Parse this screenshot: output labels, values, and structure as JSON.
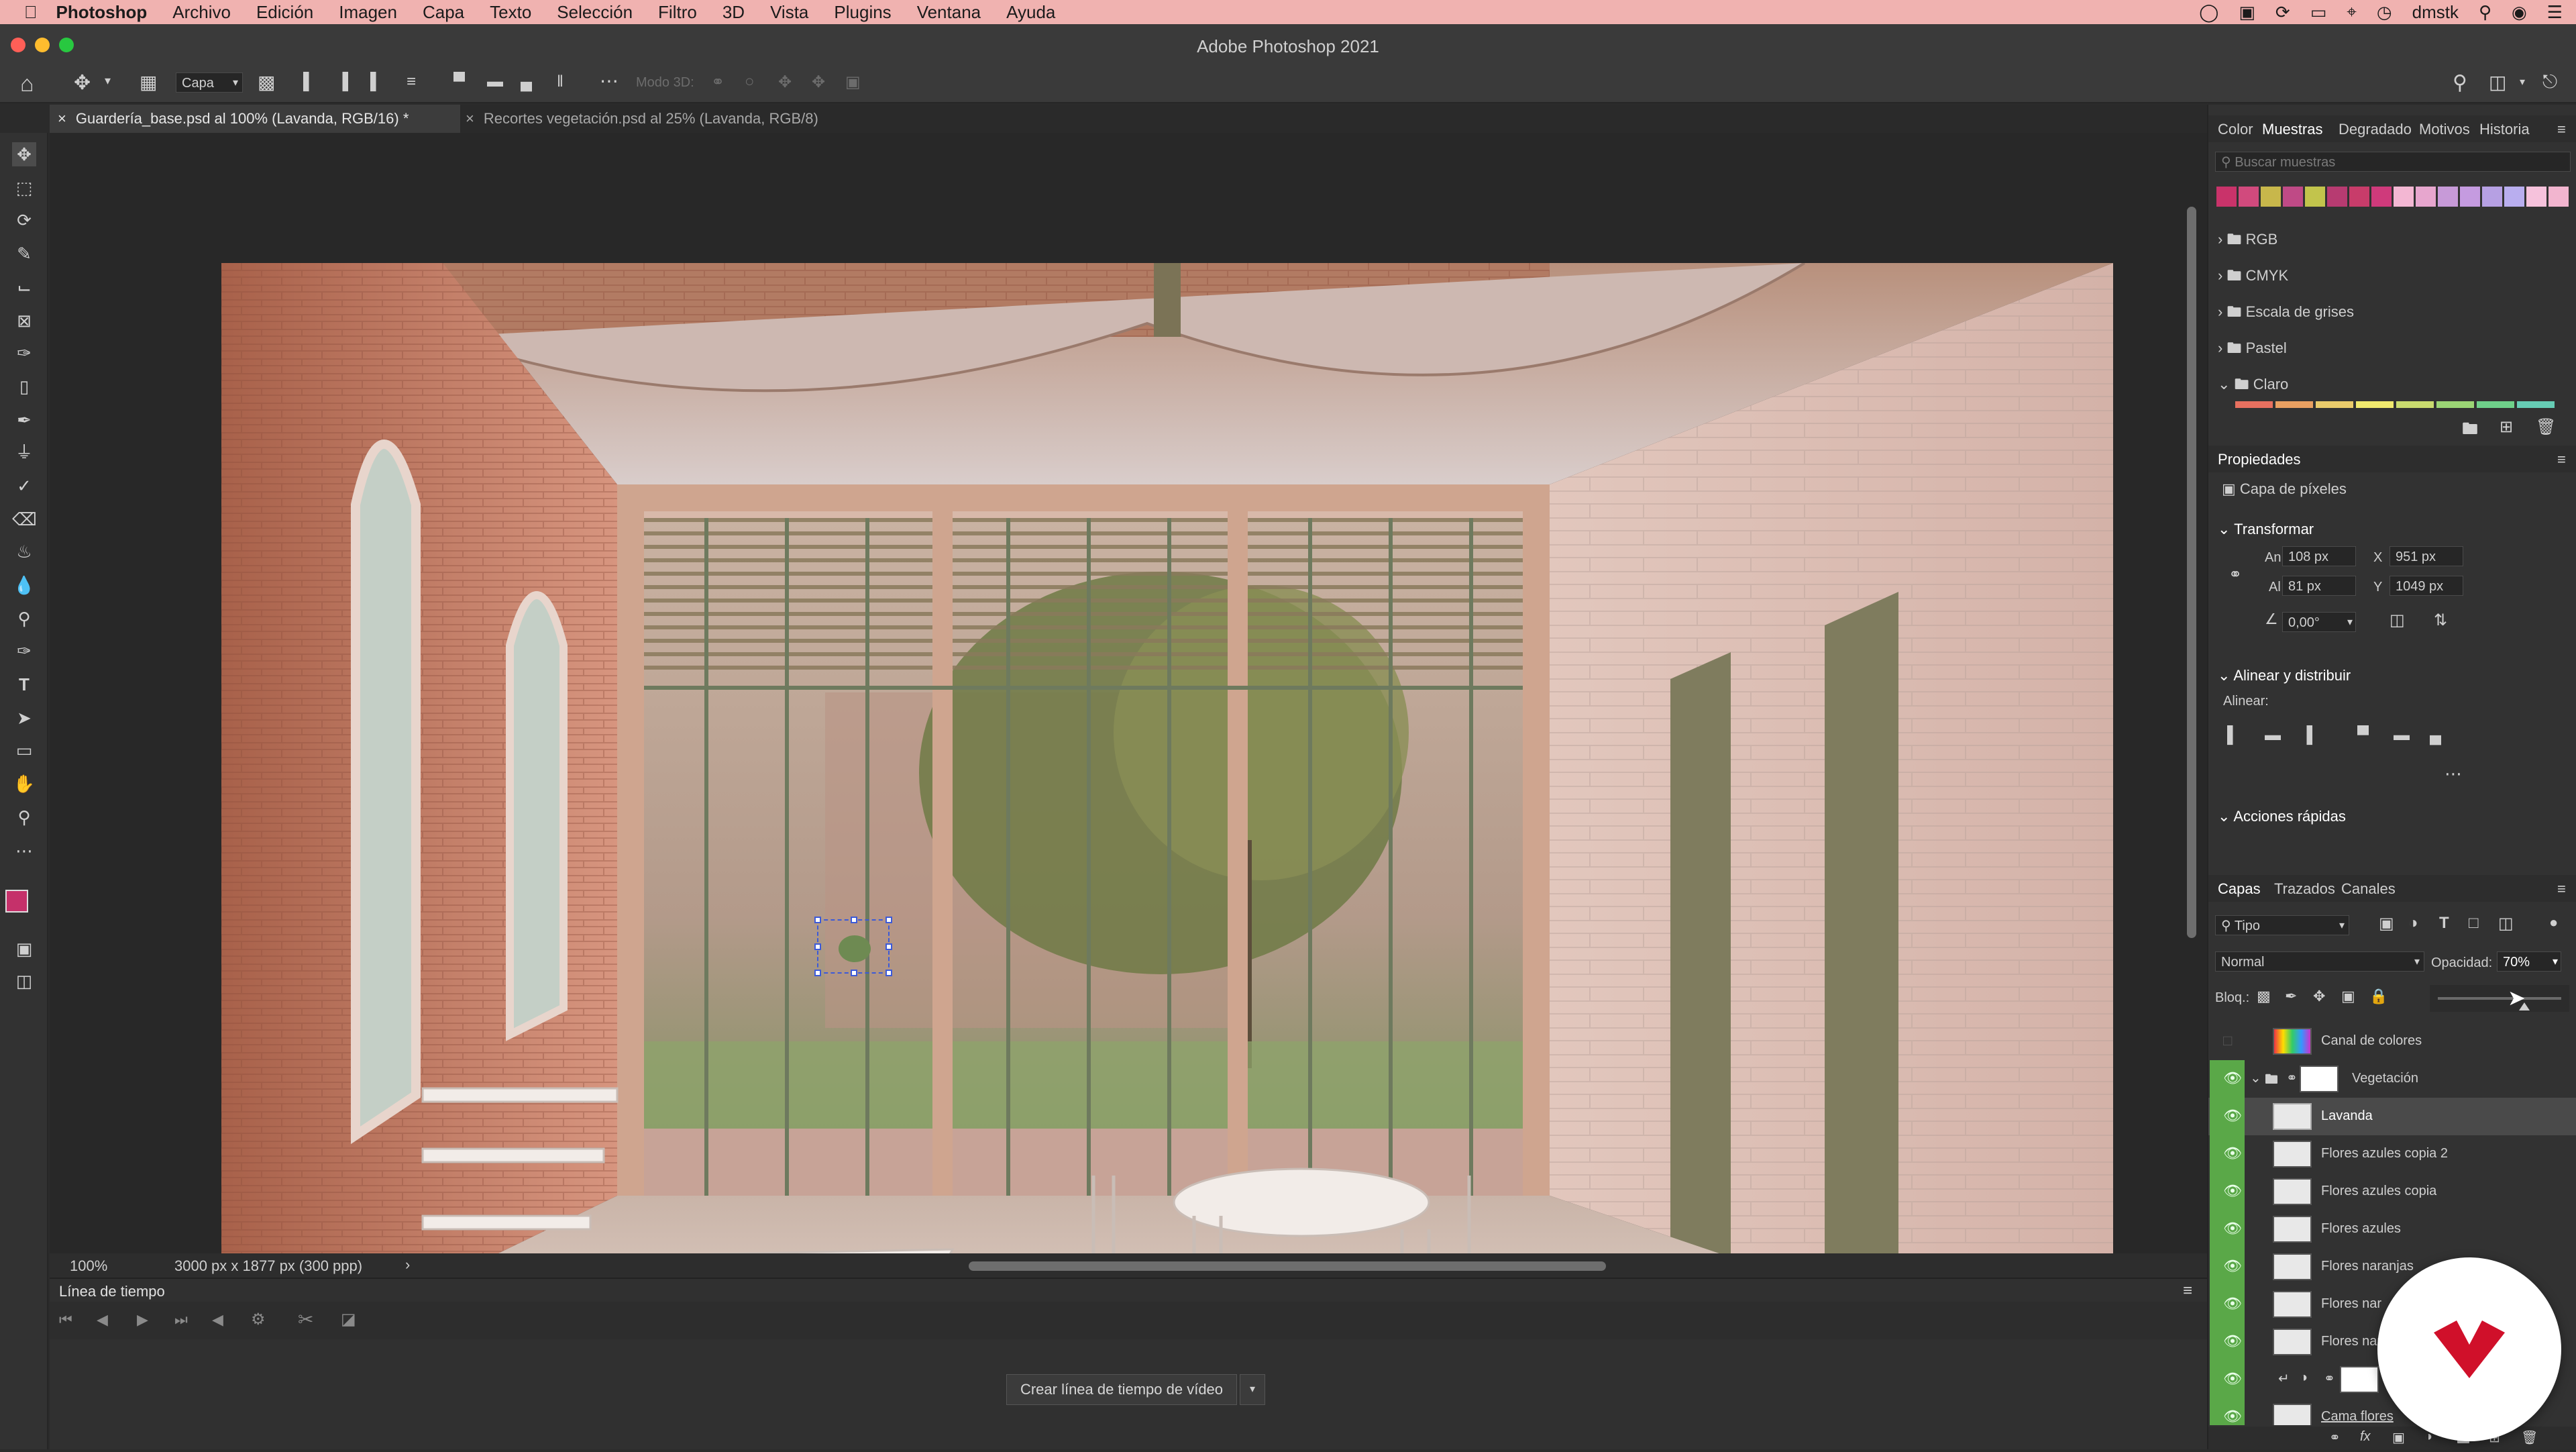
{
  "menubar": {
    "app": "Photoshop",
    "items": [
      "Archivo",
      "Edición",
      "Imagen",
      "Capa",
      "Texto",
      "Selección",
      "Filtro",
      "3D",
      "Vista",
      "Plugins",
      "Ventana",
      "Ayuda"
    ],
    "user": "dmstk"
  },
  "window": {
    "title": "Adobe Photoshop 2021"
  },
  "options": {
    "layer_select": "Capa",
    "mode3d": "Modo 3D:"
  },
  "tabs": [
    {
      "label": "Guardería_base.psd al 100% (Lavanda, RGB/16) *",
      "active": true
    },
    {
      "label": "Recortes vegetación.psd al 25% (Lavanda, RGB/8)",
      "active": false
    }
  ],
  "status": {
    "zoom": "100%",
    "doc_info": "3000 px x 1877 px (300 ppp)"
  },
  "timeline": {
    "title": "Línea de tiempo",
    "create_button": "Crear línea de tiempo de vídeo"
  },
  "swatches_panel": {
    "tabs": [
      "Color",
      "Muestras",
      "Degradado",
      "Motivos",
      "Historia"
    ],
    "active_tab": "Muestras",
    "search_placeholder": "Buscar muestras",
    "colors": [
      "#c9336a",
      "#d14a7d",
      "#c8b74b",
      "#bf4a86",
      "#c2c44c",
      "#b73b71",
      "#c83c6a",
      "#cf3a7b",
      "#f3b7d3",
      "#e7a6ce",
      "#c79ad8",
      "#c59be0",
      "#b6a0e3",
      "#b9aeef",
      "#f6c2dc",
      "#f2b5cf"
    ],
    "groups": [
      "RGB",
      "CMYK",
      "Escala de grises",
      "Pastel",
      "Claro"
    ],
    "claro_colors": [
      "#e7705f",
      "#e9a061",
      "#eacb6b",
      "#f0e96e",
      "#c9db6f",
      "#9bd575",
      "#6fd08a",
      "#66cdb5"
    ]
  },
  "properties": {
    "title": "Propiedades",
    "layer_type": "Capa de píxeles",
    "transform_title": "Transformar",
    "an_label": "An",
    "an_value": "108 px",
    "x_label": "X",
    "x_value": "951 px",
    "al_label": "Al",
    "al_value": "81 px",
    "y_label": "Y",
    "y_value": "1049 px",
    "angle": "0,00°",
    "align_title": "Alinear y distribuir",
    "align_label": "Alinear:",
    "quick_title": "Acciones rápidas"
  },
  "layers_panel": {
    "tabs": [
      "Capas",
      "Trazados",
      "Canales"
    ],
    "filter": "Tipo",
    "blend": "Normal",
    "opacity_label": "Opacidad:",
    "opacity_value": "70%",
    "lock_label": "Bloq.:",
    "layers": [
      {
        "name": "Canal de colores",
        "visible": false
      },
      {
        "name": "Vegetación",
        "visible": true
      },
      {
        "name": "Lavanda",
        "visible": true
      },
      {
        "name": "Flores azules copia 2",
        "visible": true
      },
      {
        "name": "Flores azules copia",
        "visible": true
      },
      {
        "name": "Flores azules",
        "visible": true
      },
      {
        "name": "Flores naranjas",
        "visible": true
      },
      {
        "name": "Flores nar",
        "visible": true
      },
      {
        "name": "Flores nar",
        "visible": true
      },
      {
        "name": "",
        "visible": true
      },
      {
        "name": "Cama flores",
        "visible": true
      }
    ]
  }
}
